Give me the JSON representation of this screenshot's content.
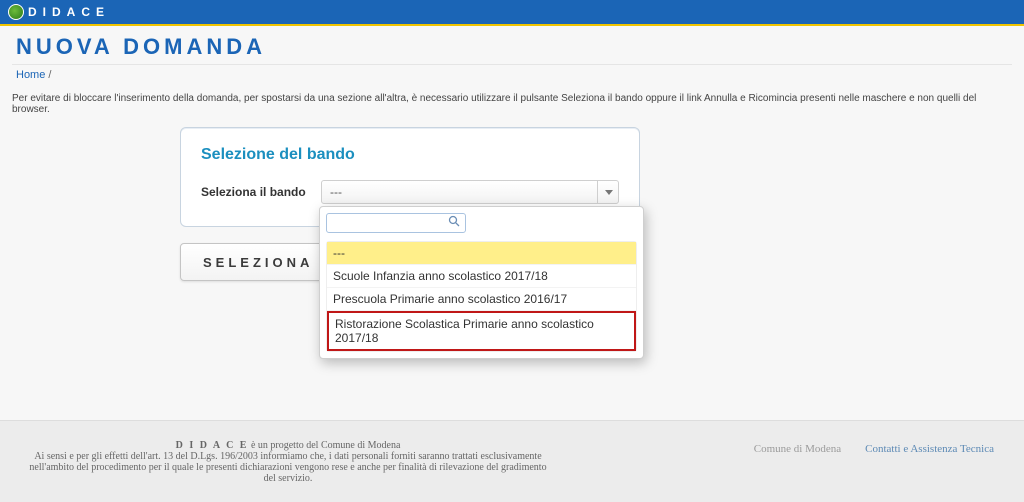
{
  "header": {
    "site_name": "DIDACE"
  },
  "page": {
    "title": "NUOVA DOMANDA"
  },
  "breadcrumb": {
    "home": "Home",
    "sep": "/"
  },
  "hint": "Per evitare di bloccare l'inserimento della domanda, per spostarsi da una sezione all'altra, è necessario utilizzare il pulsante Seleziona il bando oppure il link Annulla e Ricomincia presenti nelle maschere e non quelli del browser.",
  "card": {
    "title": "Selezione del bando",
    "field_label": "Seleziona il bando",
    "selected": "---"
  },
  "dropdown": {
    "search_value": "",
    "options": [
      "---",
      "Scuole Infanzia anno scolastico 2017/18",
      "Prescuola Primarie anno scolastico 2016/17",
      "Ristorazione Scolastica Primarie anno scolastico 2017/18"
    ]
  },
  "big_button": {
    "label": "SELEZIONA IL"
  },
  "footer": {
    "line_brand": "D I D A C E",
    "line_brand_after": " è un progetto del Comune di Modena",
    "line2": "Ai sensi e per gli effetti dell'art. 13 del D.Lgs. 196/2003 informiamo che, i dati personali forniti saranno trattati esclusivamente nell'ambito del procedimento per il quale le presenti dichiarazioni vengono rese e anche per finalità di rilevazione del gradimento del servizio.",
    "link_comune": "Comune di Modena",
    "link_tech": "Contatti e Assistenza Tecnica"
  }
}
